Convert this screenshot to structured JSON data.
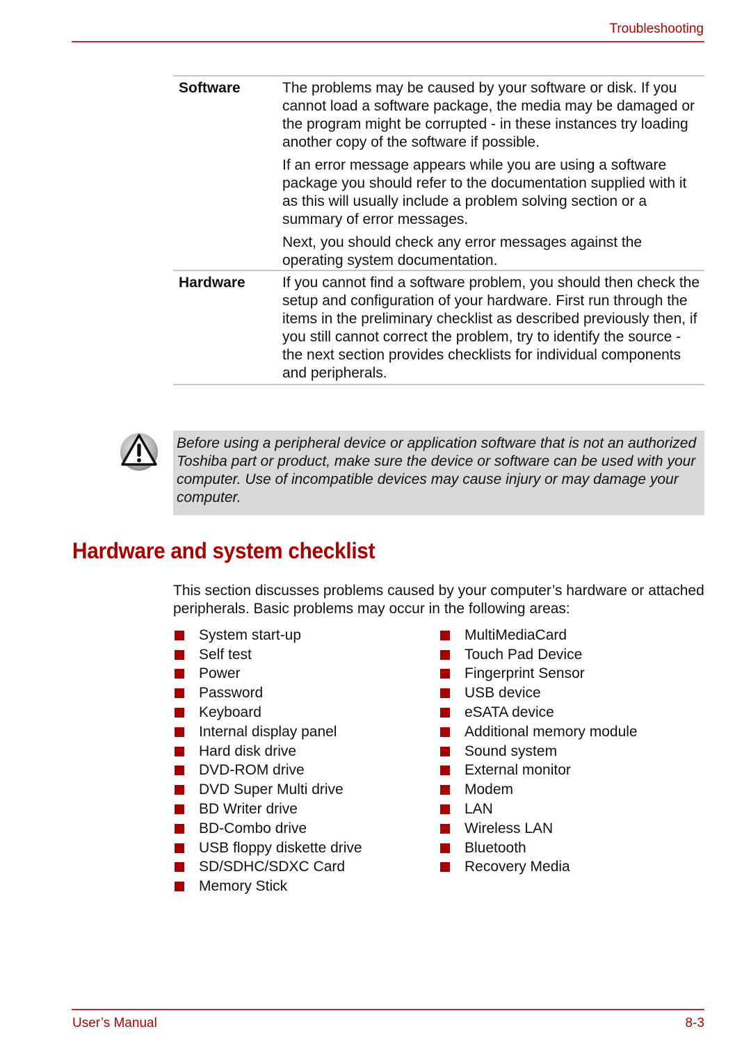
{
  "header": {
    "section": "Troubleshooting"
  },
  "definitions": [
    {
      "term": "Software",
      "paragraphs": [
        "The problems may be caused by your software or disk. If you cannot load a software package, the media may be damaged or the program might be corrupted - in these instances try loading another copy of the software if possible.",
        "If an error message appears while you are using a software package you should refer to the documentation supplied with it as this will usually include a problem solving section or a summary of error messages.",
        "Next, you should check any error messages against the operating system documentation."
      ]
    },
    {
      "term": "Hardware",
      "paragraphs": [
        "If you cannot find a software problem, you should then check the setup and configuration of your hardware. First run through the items in the preliminary checklist as described previously then, if you still cannot correct the problem, try to identify the source - the next section provides checklists for individual components and peripherals."
      ]
    }
  ],
  "warning": {
    "icon": "warning-triangle-icon",
    "text": "Before using a peripheral device or application software that is not an authorized Toshiba part or product, make sure the device or software can be used with your computer. Use of incompatible devices may cause injury or may damage your computer."
  },
  "section": {
    "title": "Hardware and system checklist",
    "intro": "This section discusses problems caused by your computer’s hardware or attached peripherals. Basic problems may occur in the following areas:",
    "list_col1": [
      "System start-up",
      "Self test",
      "Power",
      "Password",
      "Keyboard",
      "Internal display panel",
      "Hard disk drive",
      "DVD-ROM drive",
      "DVD Super Multi drive",
      "BD Writer drive",
      "BD-Combo drive",
      "USB floppy diskette drive",
      "SD/SDHC/SDXC Card",
      "Memory Stick"
    ],
    "list_col2": [
      "MultiMediaCard",
      "Touch Pad Device",
      "Fingerprint Sensor",
      "USB device",
      "eSATA device",
      "Additional memory module",
      "Sound system",
      "External monitor",
      "Modem",
      "LAN",
      "Wireless LAN",
      "Bluetooth",
      "Recovery Media"
    ]
  },
  "footer": {
    "left": "User’s Manual",
    "page": "8-3"
  },
  "colors": {
    "accent": "#a60000",
    "rule": "#c0282d",
    "note_background": "#d9d9d9"
  }
}
